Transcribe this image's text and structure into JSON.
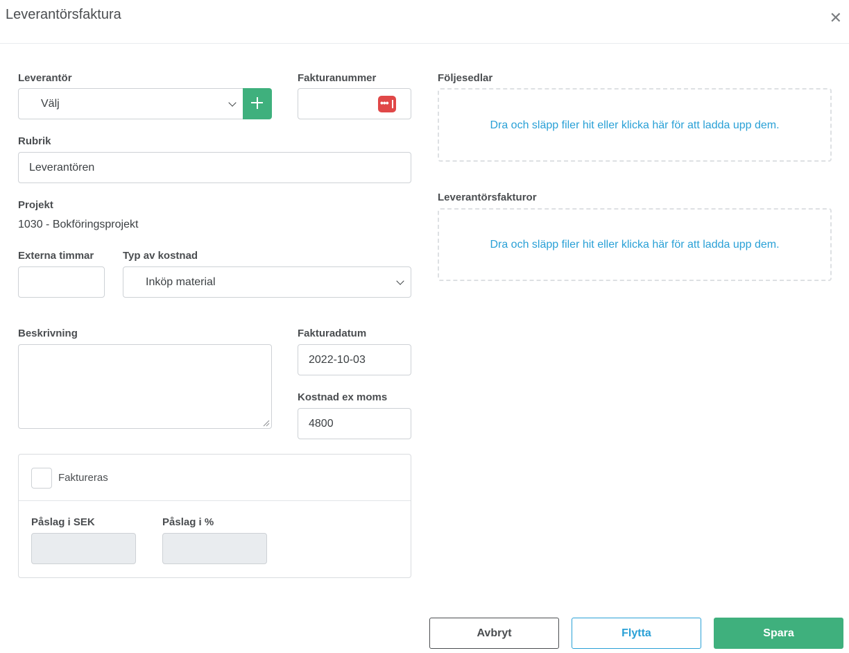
{
  "dialog": {
    "title": "Leverantörsfaktura"
  },
  "form": {
    "supplier": {
      "label": "Leverantör",
      "value": "Välj"
    },
    "invoice_number": {
      "label": "Fakturanummer",
      "value": ""
    },
    "subject": {
      "label": "Rubrik",
      "value": "Leverantören"
    },
    "project": {
      "label": "Projekt",
      "value": "1030 - Bokföringsprojekt"
    },
    "external_hours": {
      "label": "Externa timmar",
      "value": ""
    },
    "cost_type": {
      "label": "Typ av kostnad",
      "value": "Inköp material"
    },
    "description": {
      "label": "Beskrivning",
      "value": ""
    },
    "invoice_date": {
      "label": "Fakturadatum",
      "value": "2022-10-03"
    },
    "cost_ex_vat": {
      "label": "Kostnad ex moms",
      "value": "4800"
    },
    "billable": {
      "label": "Faktureras",
      "checked": false
    },
    "markup_sek": {
      "label": "Påslag i SEK",
      "value": ""
    },
    "markup_pct": {
      "label": "Påslag i %",
      "value": ""
    }
  },
  "uploads": {
    "delivery_notes": {
      "label": "Följesedlar",
      "hint": "Dra och släpp filer hit eller klicka här för att ladda upp dem."
    },
    "supplier_invoices": {
      "label": "Leverantörsfakturor",
      "hint": "Dra och släpp filer hit eller klicka här för att ladda upp dem."
    }
  },
  "actions": {
    "cancel": "Avbryt",
    "move": "Flytta",
    "save": "Spara"
  },
  "colors": {
    "accent_green": "#3fb07d",
    "accent_blue": "#29a0d6",
    "password_icon_red": "#e04848"
  }
}
